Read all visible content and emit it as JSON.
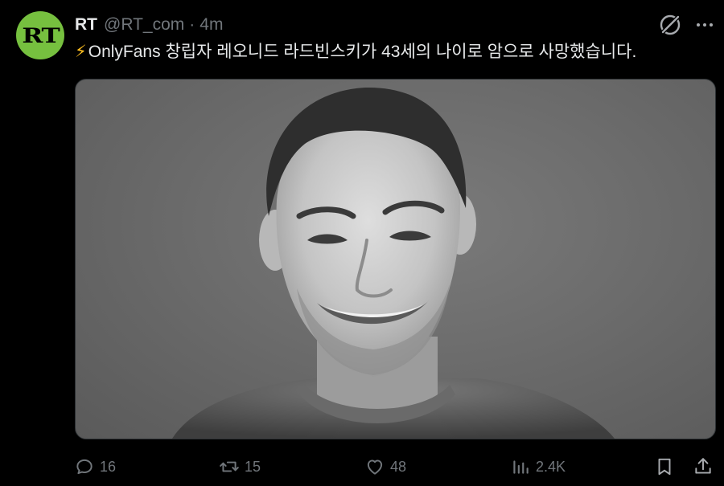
{
  "colors": {
    "background": "#000000",
    "text_primary": "#e7e9ea",
    "text_secondary": "#71767b",
    "avatar_bg": "#76c03f",
    "bolt": "#ffbf1f"
  },
  "post": {
    "avatar_text": "RT",
    "author_name": "RT",
    "handle": "@RT_com",
    "separator": "·",
    "time": "4m",
    "bolt_glyph": "⚡",
    "text": "OnlyFans 창립자 레오니드 라드빈스키가 43세의 나이로 암으로 사망했습니다.",
    "media": {
      "kind": "black-and-white portrait photo of a smiling man"
    }
  },
  "actions": {
    "reply": {
      "icon": "reply-icon",
      "count": "16"
    },
    "repost": {
      "icon": "repost-icon",
      "count": "15"
    },
    "like": {
      "icon": "heart-icon",
      "count": "48"
    },
    "views": {
      "icon": "views-icon",
      "count": "2.4K"
    },
    "bookmark": {
      "icon": "bookmark-icon"
    },
    "share": {
      "icon": "share-icon"
    }
  }
}
